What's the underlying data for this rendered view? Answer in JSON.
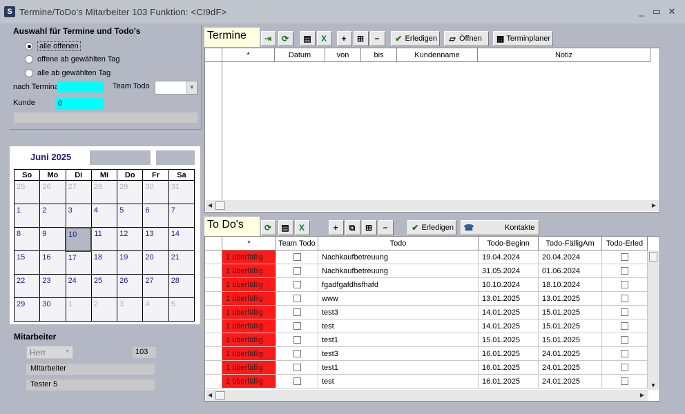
{
  "window": {
    "title": "Termine/ToDo's Mitarbeiter 103   Funktion: <CI9dF>",
    "controls": [
      "_",
      "▭",
      "✕"
    ]
  },
  "auswahl": {
    "title": "Auswahl für Termine und Todo's",
    "options": [
      "alle offenen",
      "offene ab gewählten Tag",
      "alle ab gewählten Tag"
    ],
    "selected": 0,
    "terminart_label": "nach Terminart",
    "teamtodo_label": "Team Todo",
    "kunde_label": "Kunde",
    "kunde_value": "0"
  },
  "calendar": {
    "month": "Juni 2025",
    "weekdays": [
      "So",
      "Mo",
      "Di",
      "Mi",
      "Do",
      "Fr",
      "Sa"
    ],
    "weeks": [
      [
        "25",
        "26",
        "27",
        "28",
        "29",
        "30",
        "31"
      ],
      [
        "1",
        "2",
        "3",
        "4",
        "5",
        "6",
        "7"
      ],
      [
        "8",
        "9",
        "10",
        "11",
        "12",
        "13",
        "14"
      ],
      [
        "15",
        "16",
        "17",
        "18",
        "19",
        "20",
        "21"
      ],
      [
        "22",
        "23",
        "24",
        "25",
        "26",
        "27",
        "28"
      ],
      [
        "29",
        "30",
        "1",
        "2",
        "3",
        "4",
        "5"
      ]
    ],
    "today": "10"
  },
  "mitarbeiter": {
    "title": "Mitarbeiter",
    "anrede": "Herr",
    "number": "103",
    "role": "Mitarbeiter",
    "name": "Tester 5"
  },
  "termine": {
    "title": "Termine",
    "buttons": {
      "erledigen": "Erledigen",
      "oeffnen": "Öffnen",
      "terminplaner": "Terminplaner"
    },
    "columns": [
      "*",
      "Datum",
      "von",
      "bis",
      "Kundenname",
      "Notiz"
    ]
  },
  "todos": {
    "title": "To Do's",
    "buttons": {
      "erledigen": "Erledigen",
      "kontakte": "Kontakte"
    },
    "columns": [
      "*",
      "Team Todo",
      "Todo",
      "Todo-Beginn",
      "Todo-FälligAm",
      "Todo-Erled"
    ],
    "rows": [
      {
        "status": "1 überfällig",
        "todo": "Nachkaufbetreuung",
        "beginn": "19.04.2024",
        "faellig": "20.04.2024"
      },
      {
        "status": "1 überfällig",
        "todo": "Nachkaufbetreuung",
        "beginn": "31.05.2024",
        "faellig": "01.06.2024"
      },
      {
        "status": "1 überfällig",
        "todo": "fgadfgafdhsfhafd",
        "beginn": "10.10.2024",
        "faellig": "18.10.2024"
      },
      {
        "status": "1 überfällig",
        "todo": "www",
        "beginn": "13.01.2025",
        "faellig": "13.01.2025"
      },
      {
        "status": "1 überfällig",
        "todo": "test3",
        "beginn": "14.01.2025",
        "faellig": "15.01.2025"
      },
      {
        "status": "1 überfällig",
        "todo": "test",
        "beginn": "14.01.2025",
        "faellig": "15.01.2025"
      },
      {
        "status": "1 überfällig",
        "todo": "test1",
        "beginn": "15.01.2025",
        "faellig": "15.01.2025"
      },
      {
        "status": "1 überfällig",
        "todo": "test3",
        "beginn": "16.01.2025",
        "faellig": "24.01.2025"
      },
      {
        "status": "1 überfällig",
        "todo": "test1",
        "beginn": "16.01.2025",
        "faellig": "24.01.2025"
      },
      {
        "status": "1 überfällig",
        "todo": "test",
        "beginn": "16.01.2025",
        "faellig": "24.01.2025"
      }
    ]
  },
  "colors": {
    "accent_cyan": "#00ffff",
    "overdue_red": "#ff1a1a",
    "panel_title_bg": "#ffffe0"
  }
}
